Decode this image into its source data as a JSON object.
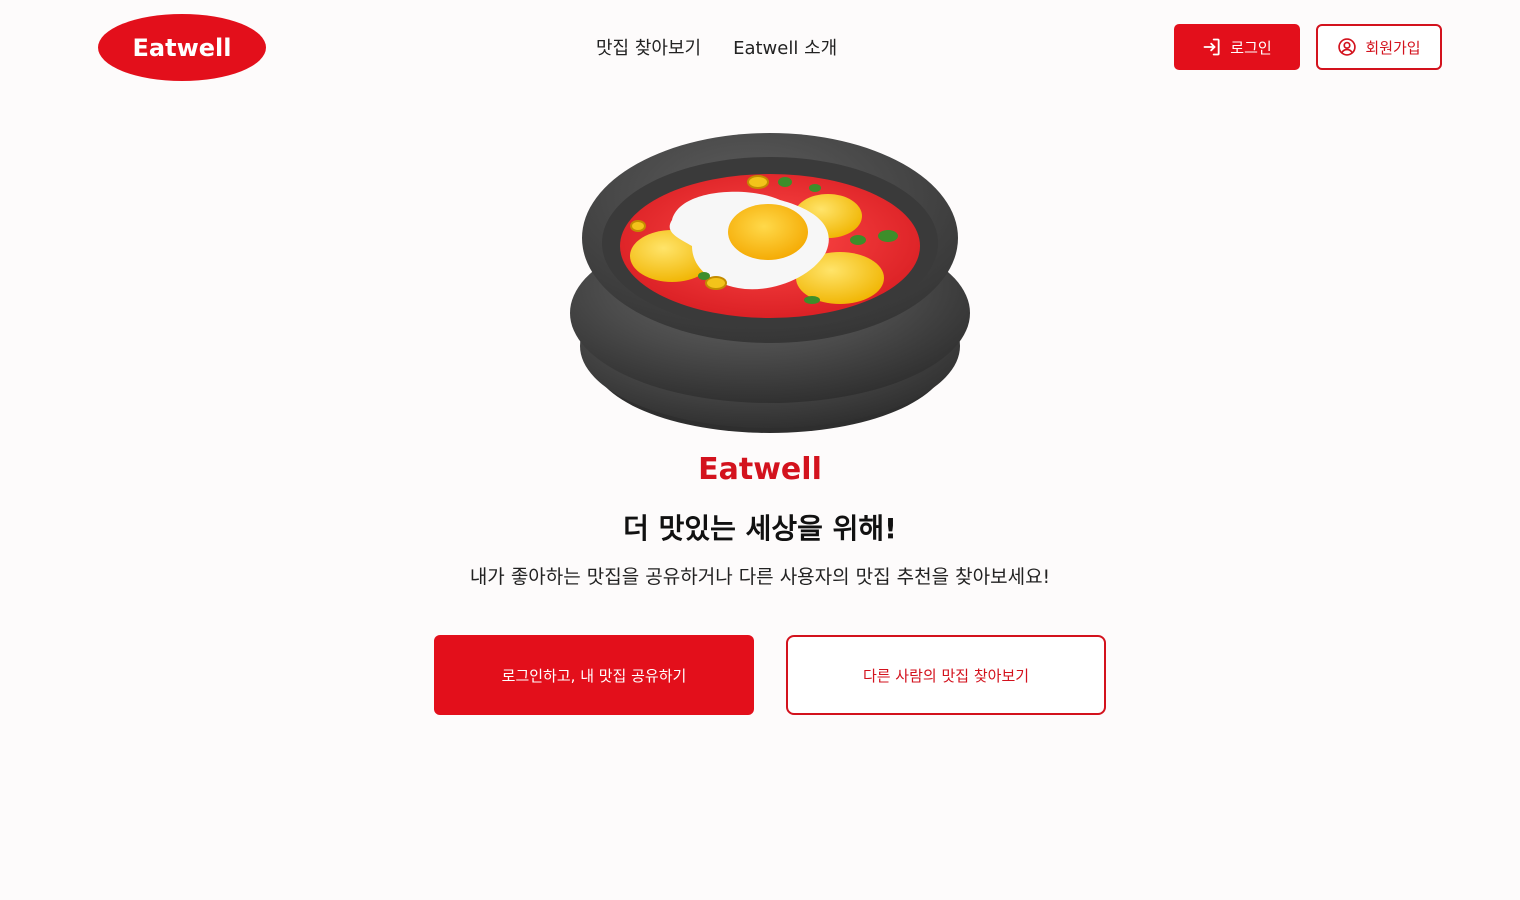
{
  "header": {
    "logo_text": "Eatwell",
    "nav": [
      {
        "label": "맛집 찾아보기"
      },
      {
        "label": "Eatwell 소개"
      }
    ],
    "login_label": "로그인",
    "signup_label": "회원가입"
  },
  "hero": {
    "image_icon": "sundubu-stew-bowl-illustration",
    "brand": "Eatwell",
    "headline": "더 맛있는 세상을 위해!",
    "subline": "내가 좋아하는 맛집을 공유하거나 다른 사용자의 맛집 추천을 찾아보세요!",
    "primary_cta": "로그인하고, 내 맛집 공유하기",
    "secondary_cta": "다른 사람의 맛집 찾아보기"
  },
  "colors": {
    "brand_red": "#e30f1b",
    "background": "#fdfbfb"
  }
}
